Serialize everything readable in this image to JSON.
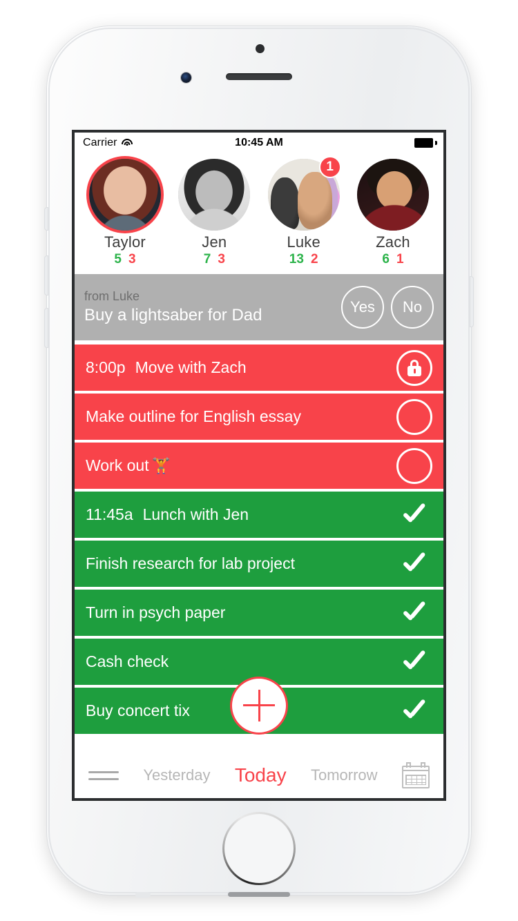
{
  "device": {
    "name": "iphone-white"
  },
  "status_bar": {
    "carrier": "Carrier",
    "wifi_icon": "wifi-icon",
    "time": "10:45 AM",
    "battery_icon": "battery-full-icon"
  },
  "friends": [
    {
      "name": "Taylor",
      "done": "5",
      "todo": "3",
      "selected": true,
      "badge": ""
    },
    {
      "name": "Jen",
      "done": "7",
      "todo": "3",
      "selected": false,
      "badge": ""
    },
    {
      "name": "Luke",
      "done": "13",
      "todo": "2",
      "selected": false,
      "badge": "1"
    },
    {
      "name": "Zach",
      "done": "6",
      "todo": "1",
      "selected": false,
      "badge": ""
    }
  ],
  "invite": {
    "from": "from Luke",
    "title": "Buy a lightsaber for Dad",
    "yes_label": "Yes",
    "no_label": "No"
  },
  "tasks": [
    {
      "time": "8:00p",
      "title": "Move with Zach",
      "state": "red",
      "right": "lock"
    },
    {
      "time": "",
      "title": "Make outline for English essay",
      "state": "red",
      "right": "circle"
    },
    {
      "time": "",
      "title": "Work out",
      "state": "red",
      "right": "circle",
      "emoji": "🏋️"
    },
    {
      "time": "11:45a",
      "title": "Lunch with Jen",
      "state": "green",
      "right": "check"
    },
    {
      "time": "",
      "title": "Finish research for lab project",
      "state": "green",
      "right": "check"
    },
    {
      "time": "",
      "title": "Turn in psych paper",
      "state": "green",
      "right": "check"
    },
    {
      "time": "",
      "title": "Cash check",
      "state": "green",
      "right": "check"
    },
    {
      "time": "",
      "title": "Buy concert tix",
      "state": "green",
      "right": "check"
    }
  ],
  "fab": {
    "label": "+",
    "name": "add-task-button"
  },
  "tabbar": {
    "menu_icon": "hamburger-menu-icon",
    "yesterday": "Yesterday",
    "today": "Today",
    "tomorrow": "Tomorrow",
    "calendar_icon": "calendar-icon"
  },
  "colors": {
    "red": "#f8434a",
    "green": "#1e9e3e",
    "count_green": "#2cb34a",
    "invite_gray": "#b0b0b0",
    "tab_inactive": "#b6b6b6"
  }
}
